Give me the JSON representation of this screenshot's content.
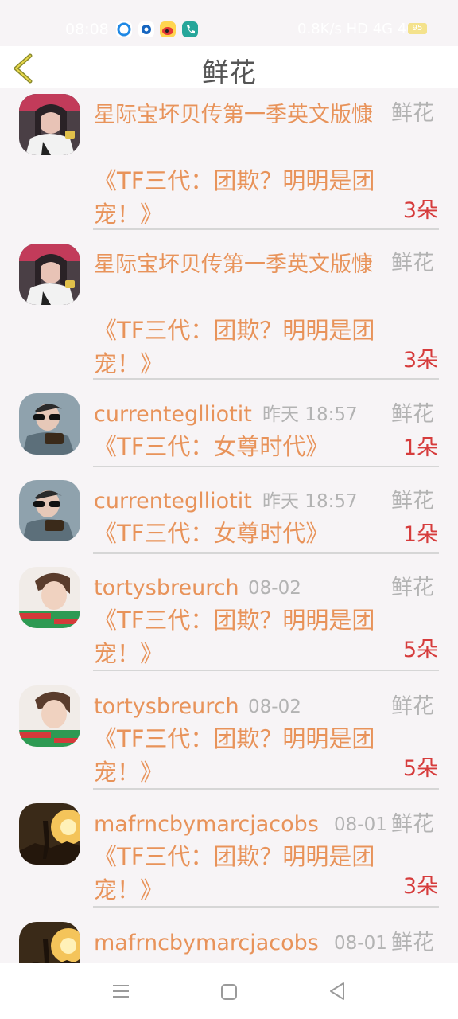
{
  "status_bar": {
    "time": "08:08",
    "right_text": "0.8K/s HD 4G 4G",
    "battery": "95"
  },
  "header": {
    "title": "鲜花"
  },
  "records": [
    {
      "name": "星际宝坏贝传第一季英文版慷",
      "time": "",
      "kind": "鲜花",
      "work": "《TF三代：团欺？明明是团宠！》",
      "count": "3朵",
      "avatar": "girl"
    },
    {
      "name": "星际宝坏贝传第一季英文版慷",
      "time": "",
      "kind": "鲜花",
      "work": "《TF三代：团欺？明明是团宠！》",
      "count": "3朵",
      "avatar": "girl"
    },
    {
      "name": "currenteglliotit",
      "time": "昨天 18:57",
      "kind": "鲜花",
      "work": "《TF三代：女尊时代》",
      "count": "1朵",
      "avatar": "boy-glasses"
    },
    {
      "name": "currenteglliotit",
      "time": "昨天 18:57",
      "kind": "鲜花",
      "work": "《TF三代：女尊时代》",
      "count": "1朵",
      "avatar": "boy-glasses"
    },
    {
      "name": "tortysbreurch",
      "time": "08-02",
      "kind": "鲜花",
      "work": "《TF三代：团欺？明明是团宠！》",
      "count": "5朵",
      "avatar": "boy-green"
    },
    {
      "name": "tortysbreurch",
      "time": "08-02",
      "kind": "鲜花",
      "work": "《TF三代：团欺？明明是团宠！》",
      "count": "5朵",
      "avatar": "boy-green"
    },
    {
      "name": "mafrncbymarcjacobs",
      "time": "08-01",
      "kind": "鲜花",
      "work": "《TF三代：团欺？明明是团宠！》",
      "count": "3朵",
      "avatar": "sunset"
    },
    {
      "name": "mafrncbymarcjacobs",
      "time": "08-01",
      "kind": "鲜花",
      "work": "",
      "count": "",
      "avatar": "sunset"
    }
  ]
}
